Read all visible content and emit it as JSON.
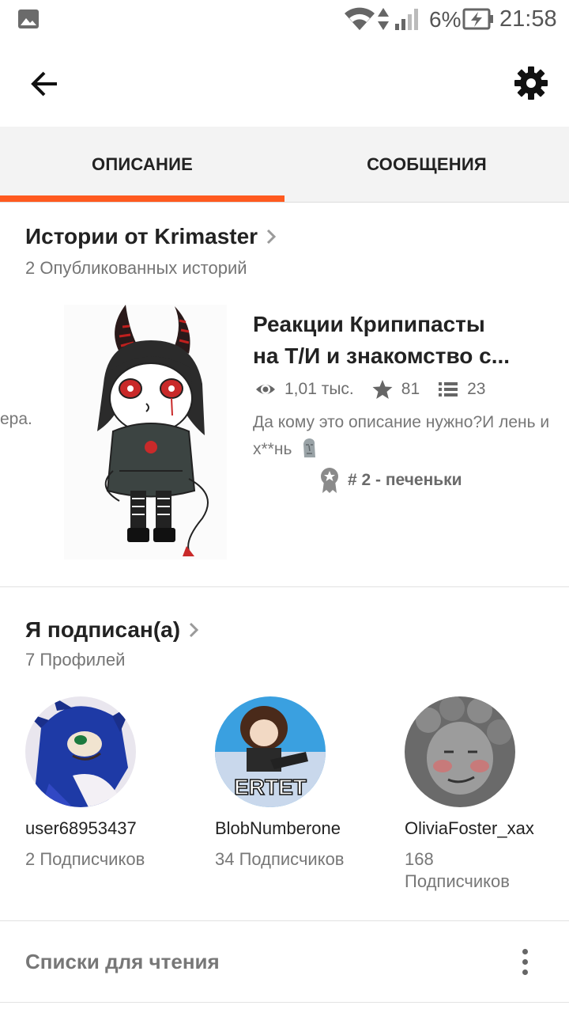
{
  "status_bar": {
    "battery": "6%",
    "time": "21:58"
  },
  "tabs": [
    {
      "label": "ОПИСАНИЕ",
      "active": true
    },
    {
      "label": "СООБЩЕНИЯ",
      "active": false
    }
  ],
  "accent_color": "#ff5a1f",
  "stories": {
    "title": "Истории от Krimaster",
    "subtitle": "2 Опубликованных историй",
    "partial_prev_text": "ера.",
    "card": {
      "title_line1": "Реакции Крипипасты",
      "title_line2": "на Т/И и знакомство с...",
      "views": "1,01 тыс.",
      "votes": "81",
      "parts": "23",
      "description": "Да кому это описание нужно?И лень и х**нь",
      "rank": "# 2 - печеньки"
    }
  },
  "following": {
    "title": "Я подписан(а)",
    "subtitle": "7 Профилей",
    "profiles": [
      {
        "name": "user68953437",
        "followers": "2 Подписчиков"
      },
      {
        "name": "BlobNumberone",
        "followers": "34 Подписчиков",
        "avatar_text": "ERTET"
      },
      {
        "name": "OliviaFoster_xax",
        "followers": "168 Подписчиков"
      }
    ]
  },
  "reading_lists": {
    "label": "Списки для чтения"
  }
}
